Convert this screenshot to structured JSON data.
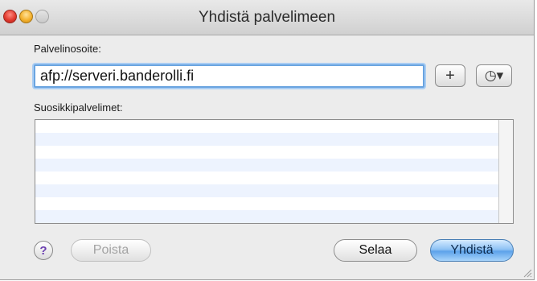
{
  "window": {
    "title": "Yhdistä palvelimeen"
  },
  "server": {
    "label": "Palvelinosoite:",
    "value": "afp://serveri.banderolli.fi",
    "add_label": "+",
    "recent_label": "◷▾"
  },
  "favorites": {
    "label": "Suosikkipalvelimet:",
    "items": []
  },
  "buttons": {
    "help": "?",
    "remove": "Poista",
    "browse": "Selaa",
    "connect": "Yhdistä"
  },
  "colors": {
    "accent": "#5da3ea",
    "focus_ring": "#a9cdf3",
    "list_alt_row": "#edf3fe"
  }
}
